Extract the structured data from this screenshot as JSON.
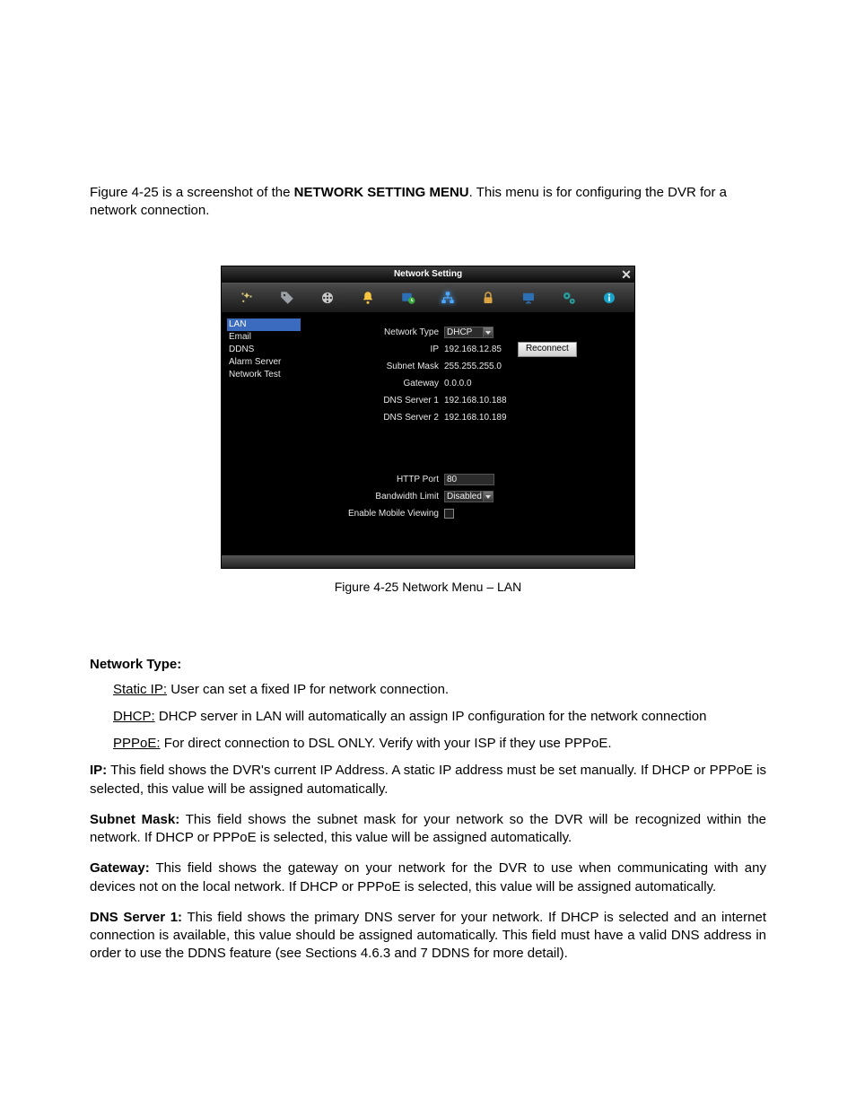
{
  "intro": {
    "prefix": "Figure 4-25 is a screenshot of the ",
    "bold": "NETWORK SETTING MENU",
    "suffix": ". This menu is for configuring the DVR for a network connection."
  },
  "dvr": {
    "title": "Network Setting",
    "close_glyph": "✕",
    "toolbar": {
      "icons": [
        "sparkles",
        "tag",
        "reel",
        "bell",
        "schedule",
        "network",
        "lock",
        "display",
        "gear",
        "info"
      ],
      "active_index": 5
    },
    "sidebar": [
      {
        "label": "LAN",
        "selected": true
      },
      {
        "label": "Email",
        "selected": false
      },
      {
        "label": "DDNS",
        "selected": false
      },
      {
        "label": "Alarm Server",
        "selected": false
      },
      {
        "label": "Network Test",
        "selected": false
      }
    ],
    "form": {
      "network_type": {
        "label": "Network Type",
        "value": "DHCP"
      },
      "ip": {
        "label": "IP",
        "value": "192.168.12.85"
      },
      "reconnect_label": "Reconnect",
      "subnet": {
        "label": "Subnet Mask",
        "value": "255.255.255.0"
      },
      "gateway": {
        "label": "Gateway",
        "value": "0.0.0.0"
      },
      "dns1": {
        "label": "DNS Server 1",
        "value": "192.168.10.188"
      },
      "dns2": {
        "label": "DNS Server 2",
        "value": "192.168.10.189"
      },
      "http": {
        "label": "HTTP Port",
        "value": "80"
      },
      "bandwidth": {
        "label": "Bandwidth Limit",
        "value": "Disabled"
      },
      "mobile": {
        "label": "Enable Mobile Viewing",
        "checked": false
      }
    }
  },
  "caption": "Figure 4-25 Network Menu – LAN",
  "network_type_head": "Network Type:",
  "bullets": {
    "static_label": "Static IP:",
    "static_text": " User can set a fixed IP for network connection.",
    "dhcp_label": "DHCP:",
    "dhcp_text": " DHCP server in LAN will automatically an assign IP configuration for the network connection",
    "pppoe_label": "PPPoE:",
    "pppoe_text": " For direct connection to DSL ONLY. Verify with your ISP if they use PPPoE."
  },
  "paras": {
    "ip_label": "IP:",
    "ip_text": " This field shows the DVR's current IP Address. A static IP address must be set manually. If DHCP or PPPoE is selected, this value will be assigned automatically.",
    "subnet_label": "Subnet Mask:",
    "subnet_text": " This field shows the subnet mask for your network so the DVR will be recognized within the network. If DHCP or PPPoE is selected, this value will be assigned automatically.",
    "gateway_label": "Gateway:",
    "gateway_text": " This field shows the gateway on your network for the DVR to use when communicating with any devices not on the local network. If DHCP or PPPoE is selected, this value will be assigned automatically.",
    "dns1_label": "DNS Server 1:",
    "dns1_text": " This field shows the primary DNS server for your network. If DHCP is selected and an internet connection is available, this value should be assigned automatically. This field must have a valid DNS address in order to use the DDNS feature (see Sections 4.6.3 and 7 DDNS for more detail)."
  }
}
